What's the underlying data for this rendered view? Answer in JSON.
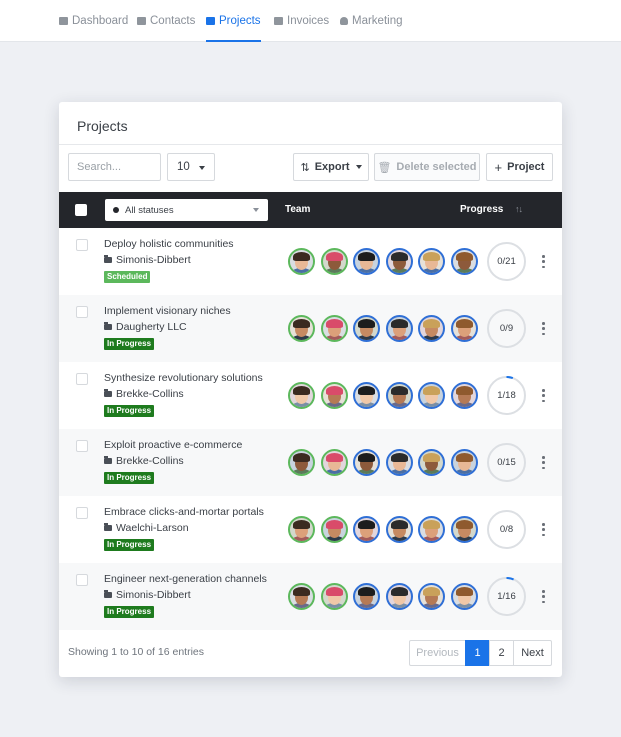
{
  "nav": {
    "items": [
      {
        "label": "Dashboard",
        "icon": "dashboard-icon",
        "active": false
      },
      {
        "label": "Contacts",
        "icon": "contacts-icon",
        "active": false
      },
      {
        "label": "Projects",
        "icon": "briefcase-icon",
        "active": true
      },
      {
        "label": "Invoices",
        "icon": "invoice-icon",
        "active": false
      },
      {
        "label": "Marketing",
        "icon": "people-icon",
        "active": false
      }
    ]
  },
  "card": {
    "title": "Projects"
  },
  "toolbar": {
    "search_placeholder": "Search...",
    "per_page": "10",
    "export_label": "Export",
    "delete_label": "Delete selected",
    "project_label": "Project"
  },
  "table": {
    "status_filter": "All statuses",
    "team_header": "Team",
    "progress_header": "Progress",
    "sort_icon": "sort-icon",
    "rows": [
      {
        "name": "Deploy holistic communities",
        "client": "Simonis-Dibbert",
        "status": "Scheduled",
        "progress": "0/21",
        "progress_fraction": 0
      },
      {
        "name": "Implement visionary niches",
        "client": "Daugherty LLC",
        "status": "In Progress",
        "progress": "0/9",
        "progress_fraction": 0
      },
      {
        "name": "Synthesize revolutionary solutions",
        "client": "Brekke-Collins",
        "status": "In Progress",
        "progress": "1/18",
        "progress_fraction": 0.0556
      },
      {
        "name": "Exploit proactive e-commerce",
        "client": "Brekke-Collins",
        "status": "In Progress",
        "progress": "0/15",
        "progress_fraction": 0
      },
      {
        "name": "Embrace clicks-and-mortar portals",
        "client": "Waelchi-Larson",
        "status": "In Progress",
        "progress": "0/8",
        "progress_fraction": 0
      },
      {
        "name": "Engineer next-generation channels",
        "client": "Simonis-Dibbert",
        "status": "In Progress",
        "progress": "1/16",
        "progress_fraction": 0.0625
      }
    ]
  },
  "footer": {
    "showing": "Showing 1 to 10 of 16 entries",
    "previous": "Previous",
    "pages": [
      "1",
      "2"
    ],
    "active_page": "1",
    "next": "Next"
  },
  "colors": {
    "accent": "#1a73e8",
    "scheduled": "#5cb85c",
    "in_progress": "#1e7b1e",
    "avatar_green_ring": "#5cb85c",
    "avatar_blue_ring": "#2f6fd6",
    "progress_ring": "#dcdfe3",
    "progress_fill": "#1a73e8"
  }
}
